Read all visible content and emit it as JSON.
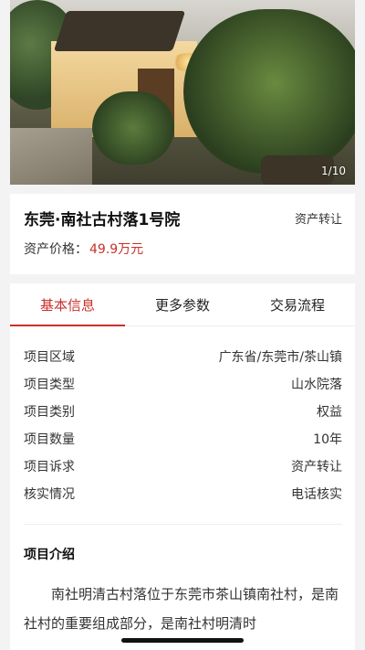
{
  "gallery": {
    "counter": "1/10"
  },
  "listing": {
    "title": "东莞·南社古村落1号院",
    "tag": "资产转让",
    "price_label": "资产价格：",
    "price_value": "49.9万元"
  },
  "tabs": [
    {
      "label": "基本信息",
      "active": true
    },
    {
      "label": "更多参数",
      "active": false
    },
    {
      "label": "交易流程",
      "active": false
    }
  ],
  "details": [
    {
      "key": "项目区域",
      "value": "广东省/东莞市/茶山镇"
    },
    {
      "key": "项目类型",
      "value": "山水院落"
    },
    {
      "key": "项目类别",
      "value": "权益"
    },
    {
      "key": "项目数量",
      "value": "10年"
    },
    {
      "key": "项目诉求",
      "value": "资产转让"
    },
    {
      "key": "核实情况",
      "value": "电话核实"
    }
  ],
  "intro": {
    "title": "项目介绍",
    "text": "南社明清古村落位于东莞市茶山镇南社村，是南社村的重要组成部分，是南社村明清时"
  },
  "colors": {
    "accent": "#c9302c"
  }
}
